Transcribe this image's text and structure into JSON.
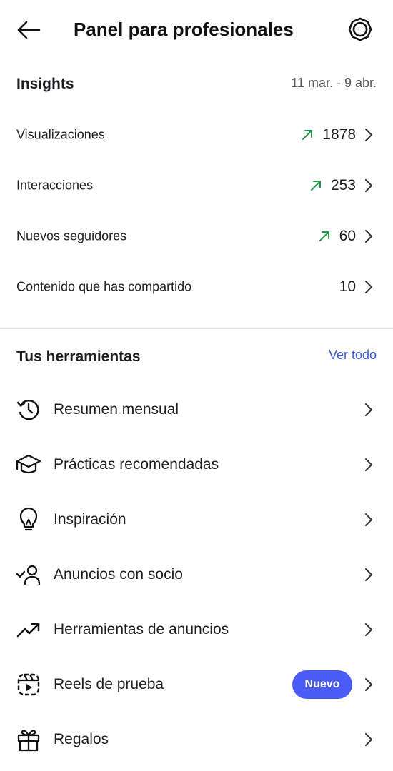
{
  "header": {
    "title": "Panel para profesionales",
    "back_icon": "arrow-left-icon",
    "settings_icon": "gear-icon"
  },
  "insights": {
    "title": "Insights",
    "date_range": "11 mar. - 9 abr.",
    "rows": [
      {
        "label": "Visualizaciones",
        "value": "1878",
        "trend": "up"
      },
      {
        "label": "Interacciones",
        "value": "253",
        "trend": "up"
      },
      {
        "label": "Nuevos seguidores",
        "value": "60",
        "trend": "up"
      },
      {
        "label": "Contenido que has compartido",
        "value": "10",
        "trend": "none"
      }
    ],
    "trend_color": "#1f9a4a"
  },
  "tools": {
    "title": "Tus herramientas",
    "see_all": "Ver todo",
    "items": [
      {
        "label": "Resumen mensual",
        "icon": "history-icon"
      },
      {
        "label": "Prácticas recomendadas",
        "icon": "graduation-cap-icon"
      },
      {
        "label": "Inspiración",
        "icon": "lightbulb-icon"
      },
      {
        "label": "Anuncios con socio",
        "icon": "partner-check-icon"
      },
      {
        "label": "Herramientas de anuncios",
        "icon": "trending-up-icon"
      },
      {
        "label": "Reels de prueba",
        "icon": "reels-test-icon",
        "badge": "Nuevo"
      },
      {
        "label": "Regalos",
        "icon": "gift-icon"
      }
    ],
    "accent_color": "#4a5cf5"
  }
}
